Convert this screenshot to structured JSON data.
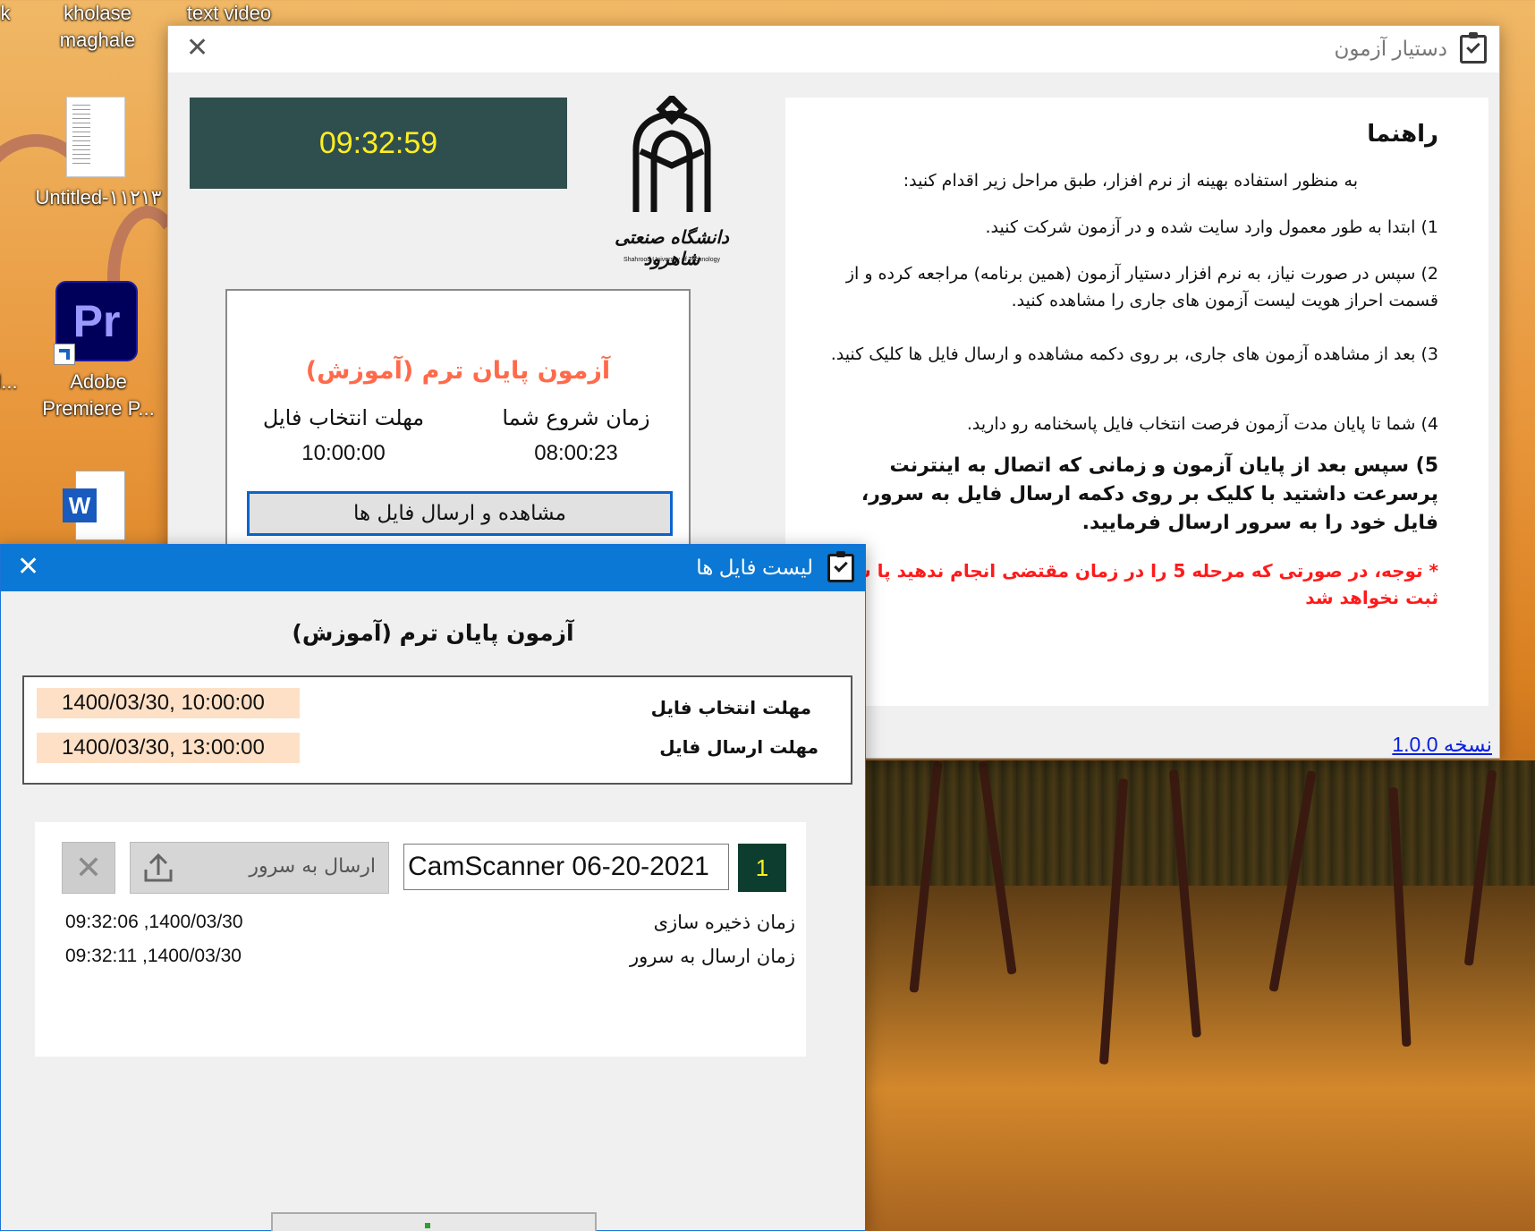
{
  "desktop": {
    "icons": [
      {
        "label": "kholase\nmaghale"
      },
      {
        "label": "text video"
      },
      {
        "label": "Untitled-۱۱۲۱۳"
      },
      {
        "label": "Adobe\nPremiere P..."
      },
      {
        "label": "k"
      },
      {
        "label": "l..."
      }
    ],
    "premiere_glyph": "Pr",
    "word_glyph": "W"
  },
  "main_window": {
    "title": "دستیار آزمون",
    "clock": "09:32:59",
    "logo_caption": "دانشگاه صنعتی شاهرود",
    "logo_caption_en": "Shahrood University of Technology",
    "exam": {
      "title": "آزمون پایان ترم (آموزش)",
      "start_label": "زمان شروع شما",
      "start_value": "08:00:23",
      "deadline_label": "مهلت انتخاب فایل",
      "deadline_value": "10:00:00",
      "view_button": "مشاهده و ارسال فایل ها"
    },
    "help": {
      "title": "راهنما",
      "intro": "به منظور استفاده بهینه از نرم افزار، طبق مراحل زیر اقدام کنید:",
      "step1": "1) ابتدا به طور معمول وارد سایت شده و در آزمون شرکت کنید.",
      "step2": "2) سپس در صورت نیاز، به نرم افزار دستیار آزمون (همین برنامه) مراجعه کرده و از قسمت احراز هویت لیست آزمون های جاری را مشاهده کنید.",
      "step3": "3) بعد از مشاهده آزمون های جاری، بر روی دکمه مشاهده و ارسال فایل ها کلیک کنید.",
      "step4": "4) شما تا پایان مدت آزمون فرصت انتخاب فایل پاسخنامه رو دارید.",
      "step5": "5) سپس بعد از پایان آزمون و زمانی که اتصال به اینترنت پرسرعت داشتید  با کلیک بر روی دکمه ارسال فایل به سرور، فایل خود را به سرور ارسال فرمایید.",
      "note": "* توجه، در صورتی که مرحله 5 را در زمان مقتضی انجام ندهید پا شما ثبت نخواهد شد"
    },
    "version_link": "نسخه 1.0.0"
  },
  "files_window": {
    "title": "لیست فایل ها",
    "exam_title": "آزمون پایان ترم (آموزش)",
    "deadlines": [
      {
        "label": "مهلت انتخاب فایل",
        "value": "1400/03/30, 10:00:00"
      },
      {
        "label": "مهلت ارسال فایل",
        "value": "1400/03/30, 13:00:00"
      }
    ],
    "file": {
      "number": "1",
      "name": "CamScanner 06-20-2021",
      "upload_button": "ارسال به سرور",
      "saved_label": "زمان ذخیره سازی",
      "saved_value": "1400/03/30, 09:32:06",
      "sent_label": "زمان ارسال به سرور",
      "sent_value": "1400/03/30, 09:32:11"
    }
  }
}
